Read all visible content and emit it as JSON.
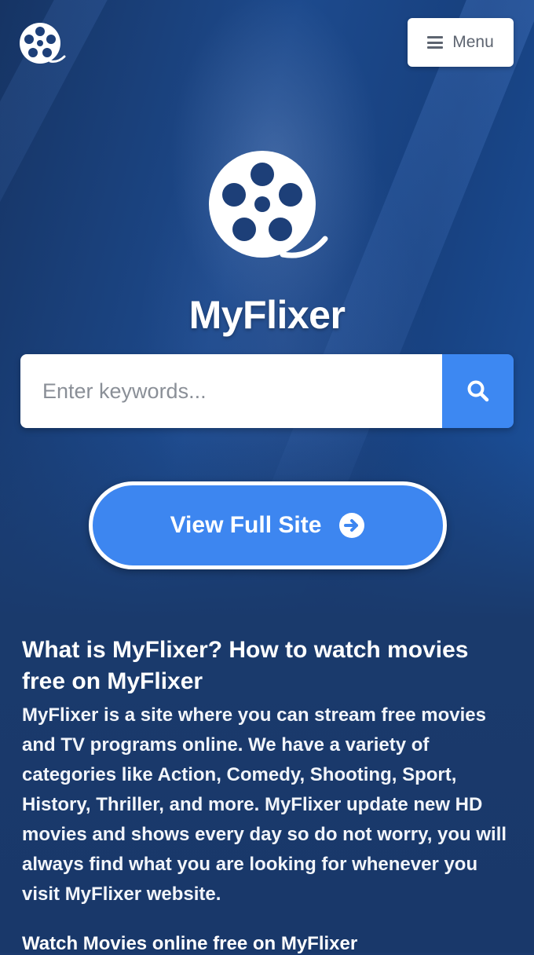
{
  "header": {
    "logo_icon": "film-reel-icon",
    "menu_label": "Menu",
    "menu_icon": "hamburger-icon"
  },
  "hero": {
    "logo_icon": "film-reel-icon",
    "title": "MyFlixer"
  },
  "search": {
    "placeholder": "Enter keywords...",
    "button_icon": "search-icon"
  },
  "cta": {
    "label": "View Full Site",
    "icon": "arrow-right-circle-icon"
  },
  "article": {
    "heading": "What is MyFlixer? How to watch movies free on MyFlixer",
    "body": "MyFlixer is a site where you can stream free movies and TV programs online. We have a variety of categories like Action, Comedy, Shooting, Sport, History, Thriller, and more. MyFlixer update new HD movies and shows every day so do not worry, you will always find what you are looking for whenever you visit MyFlixer website.",
    "subheading": "Watch Movies online free on MyFlixer"
  },
  "colors": {
    "background": "#1b3a6e",
    "accent": "#3d88f2",
    "text": "#ffffff"
  }
}
